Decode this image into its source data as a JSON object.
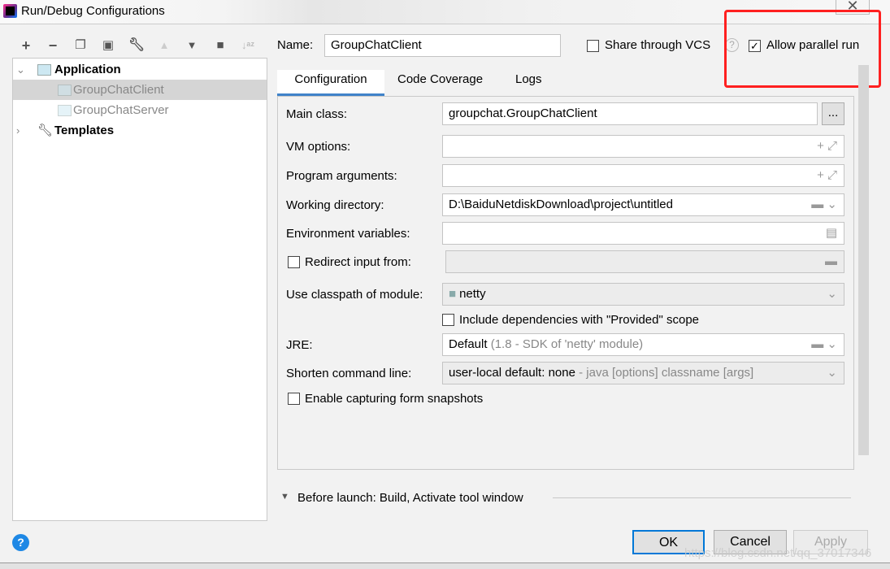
{
  "window": {
    "title": "Run/Debug Configurations",
    "close_label": "✕"
  },
  "toolbar": {
    "icons": [
      "plus-icon",
      "minus-icon",
      "copy-icon",
      "save-icon",
      "wrench-icon",
      "arrow-up-icon",
      "arrow-down-icon",
      "new-folder-icon",
      "sort-alpha-icon"
    ]
  },
  "tree": {
    "application": "Application",
    "items": [
      "GroupChatClient",
      "GroupChatServer"
    ],
    "templates": "Templates"
  },
  "header": {
    "name_label": "Name:",
    "name_value": "GroupChatClient",
    "share_vcs": "Share through VCS",
    "share_vcs_checked": false,
    "allow_parallel": "Allow parallel run",
    "allow_parallel_checked": true
  },
  "tabs": [
    "Configuration",
    "Code Coverage",
    "Logs"
  ],
  "form": {
    "main_class_label": "Main class:",
    "main_class": "groupchat.GroupChatClient",
    "browse": "...",
    "vm_options_label": "VM options:",
    "vm_options": "",
    "program_args_label": "Program arguments:",
    "program_args": "",
    "working_dir_label": "Working directory:",
    "working_dir": "D:\\BaiduNetdiskDownload\\project\\untitled",
    "env_vars_label": "Environment variables:",
    "env_vars": "",
    "redirect_label": "Redirect input from:",
    "redirect_checked": false,
    "classpath_label": "Use classpath of module:",
    "classpath": "netty",
    "include_deps": "Include dependencies with \"Provided\" scope",
    "include_deps_checked": false,
    "jre_label": "JRE:",
    "jre": "Default",
    "jre_hint": "(1.8 - SDK of 'netty' module)",
    "shorten_label": "Shorten command line:",
    "shorten": "user-local default: none",
    "shorten_hint": "- java [options] classname [args]",
    "snapshots": "Enable capturing form snapshots",
    "snapshots_checked": false
  },
  "before_launch": "Before launch: Build, Activate tool window",
  "buttons": {
    "ok": "OK",
    "cancel": "Cancel",
    "apply": "Apply",
    "help": "?"
  },
  "watermark": "https://blog.csdn.net/qq_37017346",
  "colors": {
    "highlight": "#ff2020",
    "ok_border": "#0078d7"
  }
}
